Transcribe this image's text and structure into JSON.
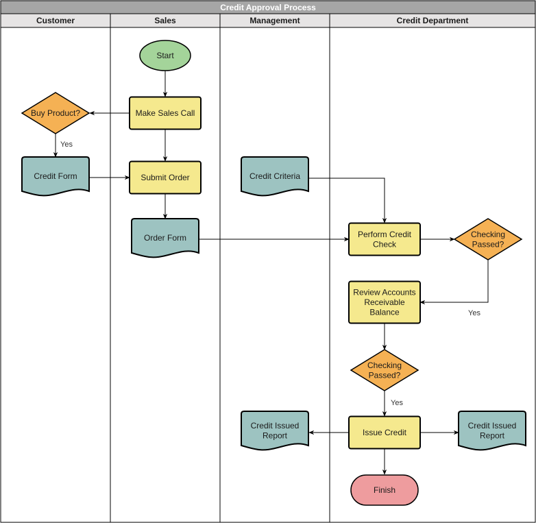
{
  "title": "Credit Approval Process",
  "colors": {
    "title_bar": "#a6a6a6",
    "lane_header": "#e6e4e4",
    "process": "#f5e98e",
    "decision": "#f5b154",
    "document": "#9dc3c1",
    "start": "#a4d49a",
    "end": "#ee9c9e",
    "stroke": "#000000"
  },
  "lanes": [
    {
      "id": "customer",
      "label": "Customer"
    },
    {
      "id": "sales",
      "label": "Sales"
    },
    {
      "id": "management",
      "label": "Management"
    },
    {
      "id": "credit",
      "label": "Credit Department"
    }
  ],
  "nodes": [
    {
      "id": "start",
      "type": "start",
      "lane": "sales",
      "lines": [
        "Start"
      ]
    },
    {
      "id": "make_sales_call",
      "type": "process",
      "lane": "sales",
      "lines": [
        "Make Sales Call"
      ]
    },
    {
      "id": "buy_product",
      "type": "decision",
      "lane": "customer",
      "lines": [
        "Buy Product?"
      ]
    },
    {
      "id": "credit_form",
      "type": "document",
      "lane": "customer",
      "lines": [
        "Credit Form"
      ]
    },
    {
      "id": "submit_order",
      "type": "process",
      "lane": "sales",
      "lines": [
        "Submit Order"
      ]
    },
    {
      "id": "order_form",
      "type": "document",
      "lane": "sales",
      "lines": [
        "Order Form"
      ]
    },
    {
      "id": "credit_criteria",
      "type": "document",
      "lane": "management",
      "lines": [
        "Credit Criteria"
      ]
    },
    {
      "id": "perform_credit_check",
      "type": "process",
      "lane": "credit",
      "lines": [
        "Perform Credit",
        "Check"
      ]
    },
    {
      "id": "checking_passed_1",
      "type": "decision",
      "lane": "credit",
      "lines": [
        "Checking",
        "Passed?"
      ]
    },
    {
      "id": "review_accounts",
      "type": "process",
      "lane": "credit",
      "lines": [
        "Review Accounts",
        "Receivable",
        "Balance"
      ]
    },
    {
      "id": "checking_passed_2",
      "type": "decision",
      "lane": "credit",
      "lines": [
        "Checking",
        "Passed?"
      ]
    },
    {
      "id": "issue_credit",
      "type": "process",
      "lane": "credit",
      "lines": [
        "Issue Credit"
      ]
    },
    {
      "id": "credit_issued_report_mgmt",
      "type": "document",
      "lane": "management",
      "lines": [
        "Credit Issued",
        "Report"
      ]
    },
    {
      "id": "credit_issued_report_credit",
      "type": "document",
      "lane": "credit",
      "lines": [
        "Credit Issued",
        "Report"
      ]
    },
    {
      "id": "finish",
      "type": "end",
      "lane": "credit",
      "lines": [
        "Finish"
      ]
    }
  ],
  "edges": [
    {
      "from": "start",
      "to": "make_sales_call",
      "label": ""
    },
    {
      "from": "make_sales_call",
      "to": "buy_product",
      "label": ""
    },
    {
      "from": "buy_product",
      "to": "credit_form",
      "label": "Yes"
    },
    {
      "from": "make_sales_call",
      "to": "submit_order",
      "label": ""
    },
    {
      "from": "credit_form",
      "to": "submit_order",
      "label": ""
    },
    {
      "from": "submit_order",
      "to": "order_form",
      "label": ""
    },
    {
      "from": "credit_criteria",
      "to": "perform_credit_check",
      "label": ""
    },
    {
      "from": "order_form",
      "to": "perform_credit_check",
      "label": ""
    },
    {
      "from": "perform_credit_check",
      "to": "checking_passed_1",
      "label": ""
    },
    {
      "from": "checking_passed_1",
      "to": "review_accounts",
      "label": "Yes"
    },
    {
      "from": "review_accounts",
      "to": "checking_passed_2",
      "label": ""
    },
    {
      "from": "checking_passed_2",
      "to": "issue_credit",
      "label": "Yes"
    },
    {
      "from": "issue_credit",
      "to": "credit_issued_report_mgmt",
      "label": ""
    },
    {
      "from": "issue_credit",
      "to": "credit_issued_report_credit",
      "label": ""
    },
    {
      "from": "issue_credit",
      "to": "finish",
      "label": ""
    }
  ]
}
